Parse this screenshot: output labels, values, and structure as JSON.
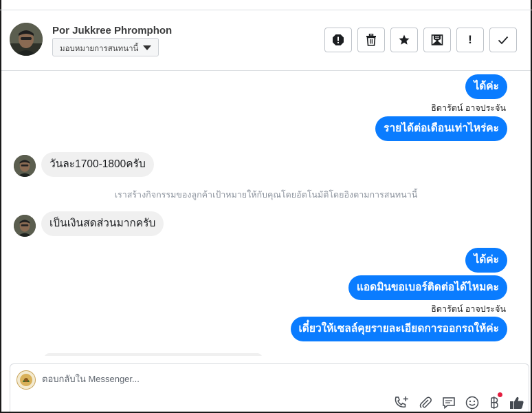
{
  "header": {
    "contact_name": "Por Jukkree Phromphon",
    "assign_label": "มอบหมายการสนทนานี้"
  },
  "toolbar": {
    "buttons": [
      "spam-icon",
      "trash-icon",
      "star-icon",
      "mark-unread-icon",
      "follow-up-icon",
      "done-icon"
    ],
    "follow_up_glyph": "!"
  },
  "messages": [
    {
      "type": "out",
      "text": "ได้ค่ะ"
    },
    {
      "type": "sender",
      "text": "ธิดารัตน์ อาจประจัน"
    },
    {
      "type": "out",
      "text": "รายได้ต่อเดือนเท่าไหร่คะ"
    },
    {
      "type": "in",
      "text": "วันละ1700-1800ครับ"
    },
    {
      "type": "system",
      "text": "เราสร้างกิจกรรมของลูกค้าเป้าหมายให้กับคุณโดยอัตโนมัติโดยอิงตามการสนทนานี้"
    },
    {
      "type": "in",
      "text": "เป็นเงินสดส่วนมากครับ"
    },
    {
      "type": "out",
      "text": "ได้ค่ะ"
    },
    {
      "type": "out",
      "text": "แอดมินขอเบอร์ติดต่อได้ไหมคะ"
    },
    {
      "type": "sender",
      "text": "ธิดารัตน์ อาจประจัน"
    },
    {
      "type": "out",
      "text": "เดี๋ยวให้เซลล์คุยรายละเอียดการออกรถให้ค่ะ"
    }
  ],
  "composer": {
    "placeholder": "ตอบกลับใน Messenger..."
  },
  "composer_tools": [
    "phone-add-icon",
    "attachment-icon",
    "saved-replies-icon",
    "emoji-icon",
    "baht-payment-icon",
    "like-icon"
  ],
  "colors": {
    "outgoing_bubble": "#0a7cff",
    "incoming_bubble": "#f0f0f0",
    "system_text": "#8d949e",
    "notification_dot": "#e41e3f"
  }
}
